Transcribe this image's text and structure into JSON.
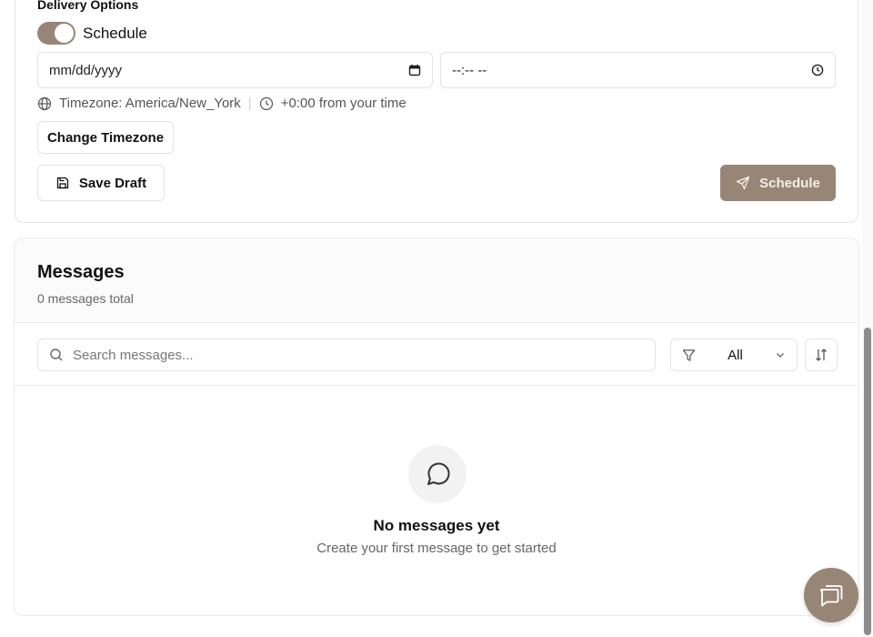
{
  "delivery": {
    "section_label": "Delivery Options",
    "schedule_toggle_label": "Schedule",
    "schedule_toggle_on": true,
    "date_placeholder": "mm/dd/yyyy",
    "time_placeholder": "--:-- --",
    "timezone_text": "Timezone: America/New_York",
    "offset_text": "+0:00 from your time",
    "change_timezone_label": "Change Timezone",
    "save_draft_label": "Save Draft",
    "schedule_button_label": "Schedule"
  },
  "messages": {
    "title": "Messages",
    "count_text": "0 messages total",
    "search_placeholder": "Search messages...",
    "filter_value": "All",
    "empty_title": "No messages yet",
    "empty_subtitle": "Create your first message to get started"
  },
  "colors": {
    "accent": "#978676",
    "border": "#e3e3e3",
    "muted_text": "#666666"
  },
  "icons": {
    "calendar": "calendar-icon",
    "clock": "clock-icon",
    "globe": "globe-icon",
    "save": "save-icon",
    "send": "send-icon",
    "search": "search-icon",
    "filter": "filter-icon",
    "chevron": "chevron-down-icon",
    "sort": "sort-icon",
    "message": "message-circle-icon",
    "chat": "chat-icon"
  }
}
